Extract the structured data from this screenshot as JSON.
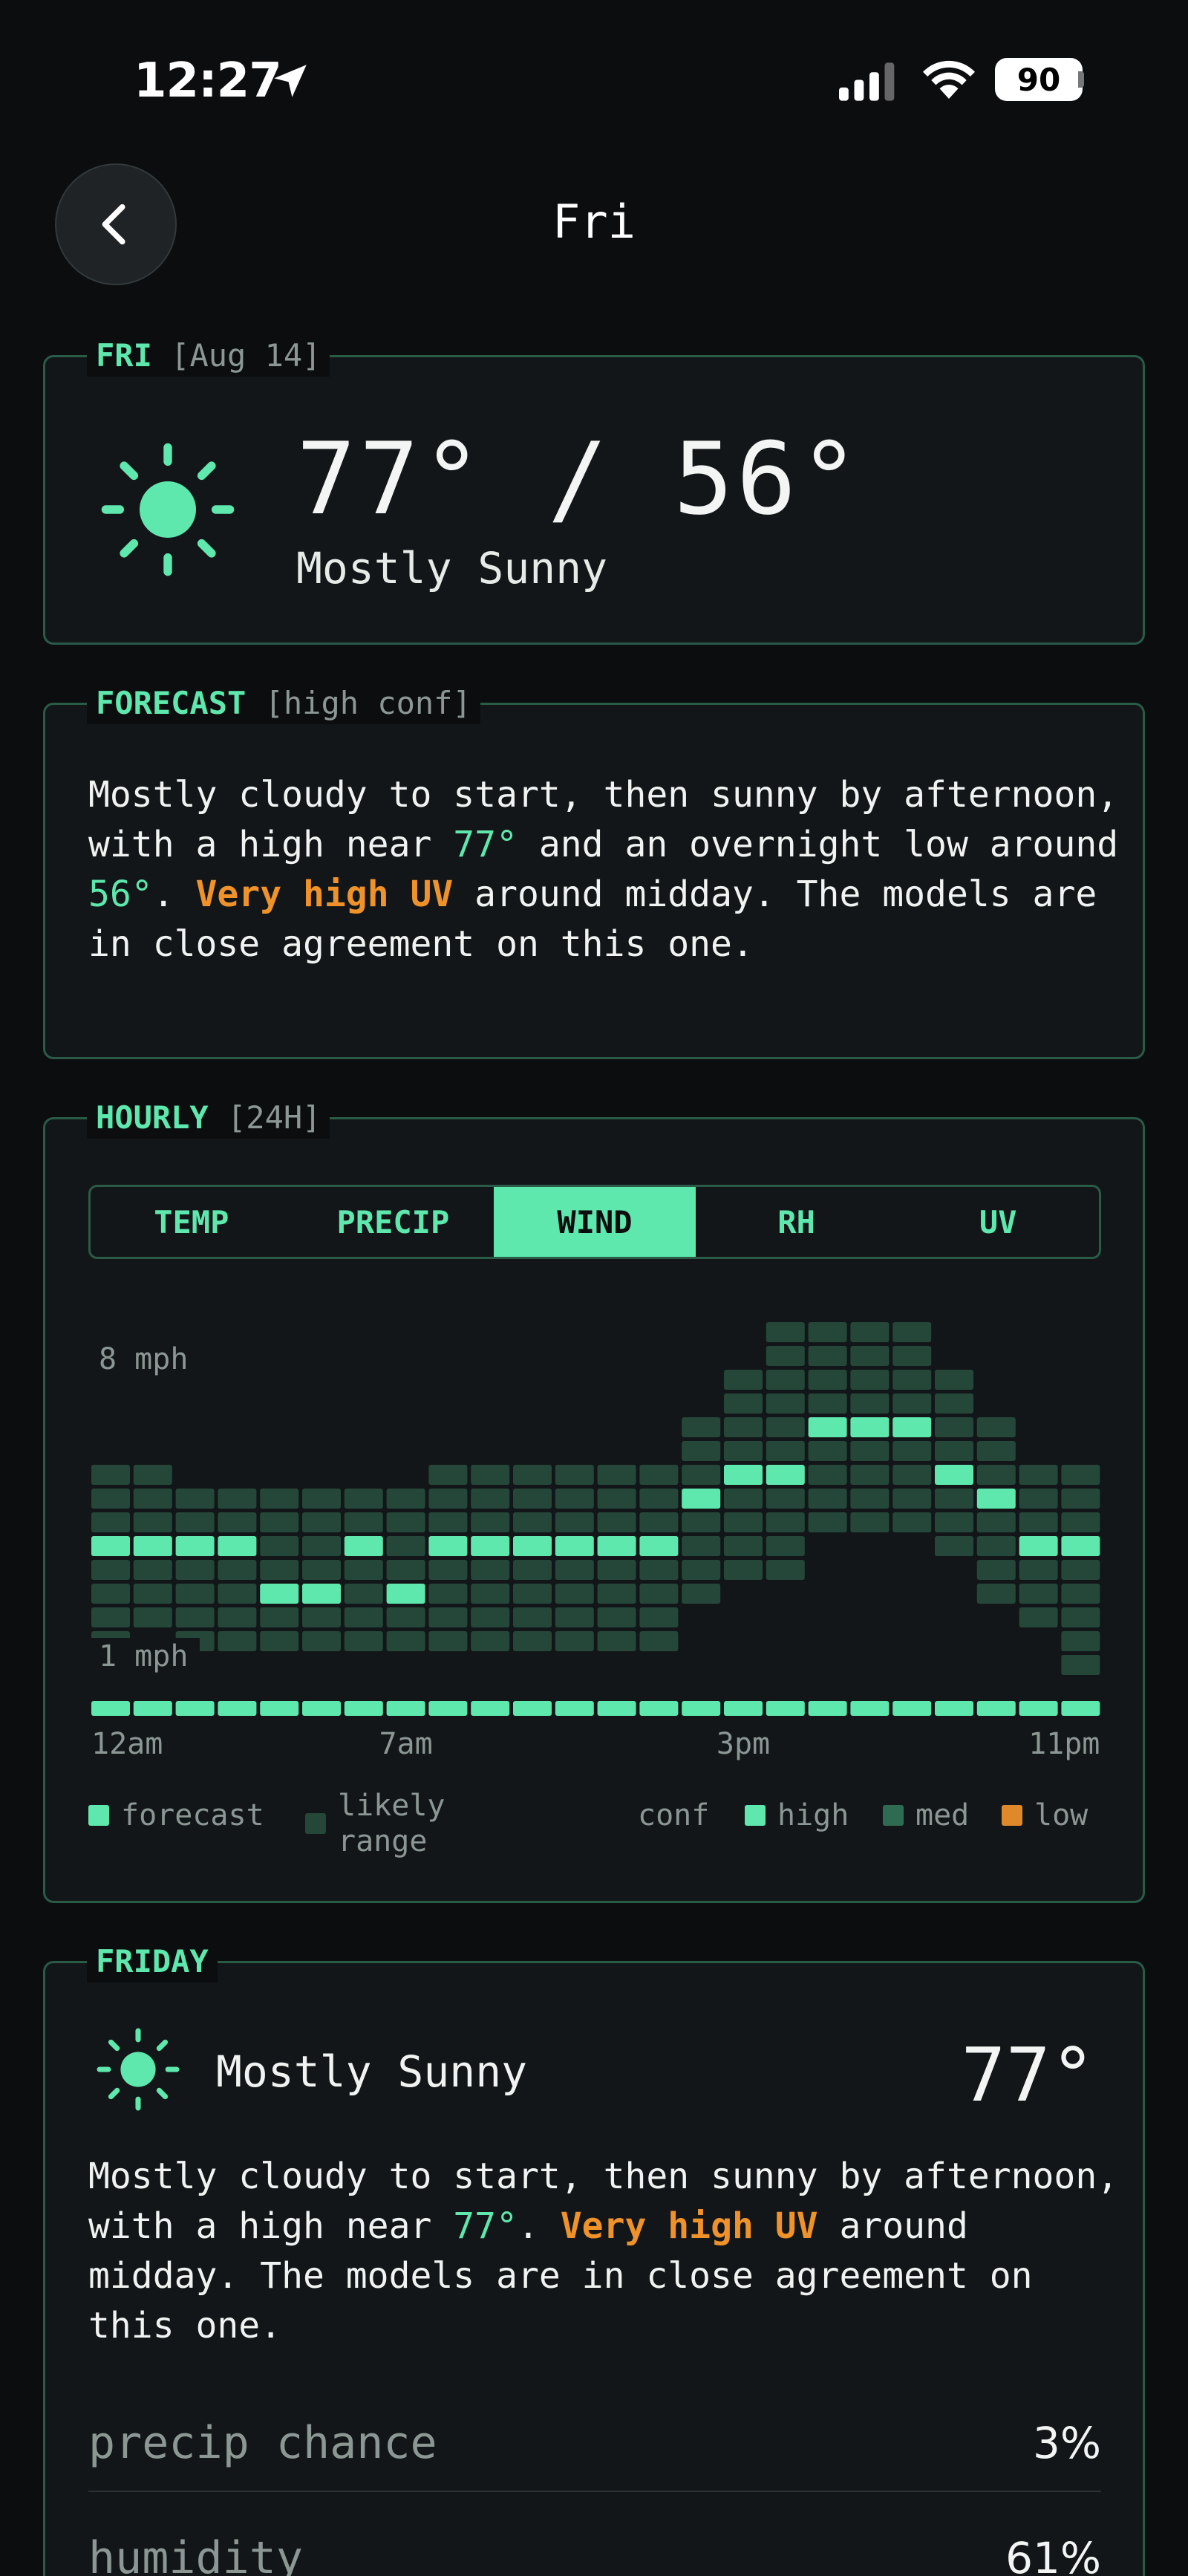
{
  "status_bar": {
    "time": "12:27",
    "battery": "90"
  },
  "nav": {
    "title": "Fri"
  },
  "today": {
    "label": "FRI",
    "date": "[Aug 14]",
    "temp_range": "77° / 56°",
    "condition": "Mostly Sunny",
    "icon": "sun-icon"
  },
  "forecast": {
    "label": "FORECAST",
    "confidence": "[high conf]",
    "text_parts": [
      "Mostly cloudy to start, then sunny by afternoon, with a high near ",
      "77°",
      " and an overnight low around ",
      "56°",
      ". ",
      "Very high UV",
      " around midday. The models are in close agreement on this one."
    ]
  },
  "hourly": {
    "label": "HOURLY",
    "range": "[24H]",
    "tabs": [
      {
        "label": "TEMP",
        "active": false
      },
      {
        "label": "PRECIP",
        "active": false
      },
      {
        "label": "WIND",
        "active": true
      },
      {
        "label": "RH",
        "active": false
      },
      {
        "label": "UV",
        "active": false
      }
    ],
    "legend": {
      "forecast": "forecast",
      "likely_range_1": "likely",
      "likely_range_2": "range",
      "conf": "conf",
      "high": "high",
      "med": "med",
      "low": "low"
    }
  },
  "chart_data": {
    "type": "heatmap",
    "metric": "wind",
    "unit": "mph",
    "axis_labels": [
      "8 mph",
      "1 mph"
    ],
    "x_tick_labels": [
      "12am",
      "7am",
      "3pm",
      "11pm"
    ],
    "x_tick_hours": [
      0,
      7,
      15,
      23
    ],
    "hours": [
      0,
      1,
      2,
      3,
      4,
      5,
      6,
      7,
      8,
      9,
      10,
      11,
      12,
      13,
      14,
      15,
      15,
      16,
      17,
      18,
      19,
      20,
      21,
      22,
      23
    ],
    "columns": [
      {
        "low": 2,
        "high": 9,
        "forecast": 6,
        "conf": "high"
      },
      {
        "low": 3,
        "high": 9,
        "forecast": 6,
        "conf": "high"
      },
      {
        "low": 2,
        "high": 8,
        "forecast": 6,
        "conf": "high"
      },
      {
        "low": 2,
        "high": 8,
        "forecast": 6,
        "conf": "high"
      },
      {
        "low": 2,
        "high": 8,
        "forecast": 4,
        "conf": "high"
      },
      {
        "low": 2,
        "high": 8,
        "forecast": 4,
        "conf": "high"
      },
      {
        "low": 2,
        "high": 8,
        "forecast": 6,
        "conf": "high"
      },
      {
        "low": 2,
        "high": 8,
        "forecast": 4,
        "conf": "high"
      },
      {
        "low": 2,
        "high": 9,
        "forecast": 6,
        "conf": "high"
      },
      {
        "low": 2,
        "high": 9,
        "forecast": 6,
        "conf": "high"
      },
      {
        "low": 2,
        "high": 9,
        "forecast": 6,
        "conf": "high"
      },
      {
        "low": 2,
        "high": 9,
        "forecast": 6,
        "conf": "high"
      },
      {
        "low": 2,
        "high": 9,
        "forecast": 6,
        "conf": "high"
      },
      {
        "low": 2,
        "high": 9,
        "forecast": 6,
        "conf": "high"
      },
      {
        "low": 4,
        "high": 11,
        "forecast": 8,
        "conf": "high"
      },
      {
        "low": 5,
        "high": 13,
        "forecast": 9,
        "conf": "high"
      },
      {
        "low": 5,
        "high": 15,
        "forecast": 9,
        "conf": "high"
      },
      {
        "low": 7,
        "high": 15,
        "forecast": 11,
        "conf": "high"
      },
      {
        "low": 7,
        "high": 15,
        "forecast": 11,
        "conf": "high"
      },
      {
        "low": 7,
        "high": 15,
        "forecast": 11,
        "conf": "high"
      },
      {
        "low": 6,
        "high": 13,
        "forecast": 9,
        "conf": "high"
      },
      {
        "low": 4,
        "high": 11,
        "forecast": 8,
        "conf": "high"
      },
      {
        "low": 3,
        "high": 9,
        "forecast": 6,
        "conf": "high"
      },
      {
        "low": 1,
        "high": 9,
        "forecast": 6,
        "conf": "high"
      }
    ],
    "colors": {
      "forecast": "#5ee8ad",
      "range": "#244739",
      "high": "#5ee8ad",
      "med": "#2f6b52",
      "low": "#e0892a"
    }
  },
  "day": {
    "label": "FRIDAY",
    "condition": "Mostly Sunny",
    "temp": "77°",
    "text_parts": [
      "Mostly cloudy to start, then sunny by afternoon, with a high near ",
      "77°",
      ". ",
      "Very high UV",
      " around midday. The models are in close agreement on this one."
    ],
    "stats": [
      {
        "label": "precip chance",
        "value": "3%"
      },
      {
        "label": "humidity",
        "value": "61%"
      }
    ]
  }
}
